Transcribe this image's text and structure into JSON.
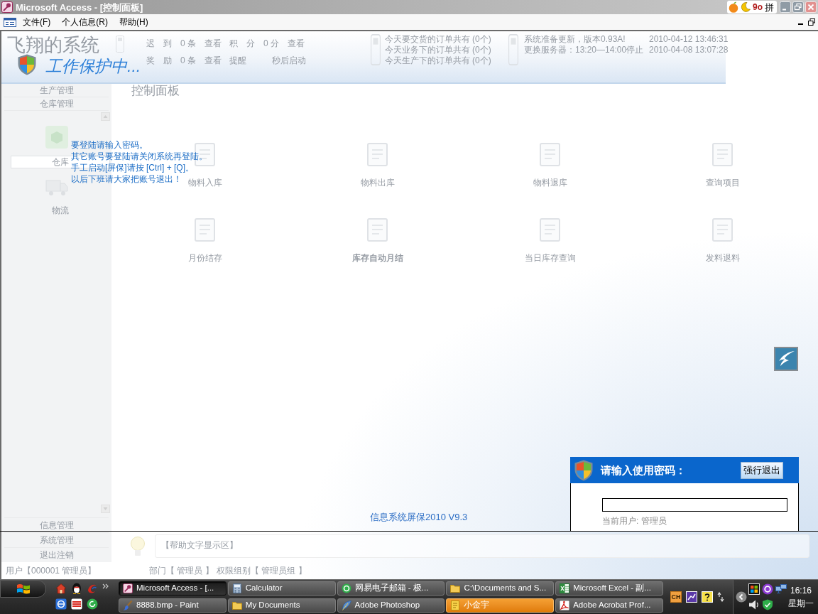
{
  "window": {
    "title": "Microsoft Access - [控制面板]"
  },
  "ime_toolbar": {
    "symbol": "9o",
    "mode": "拼"
  },
  "menu": {
    "items": [
      "文件(F)",
      "个人信息(R)",
      "帮助(H)"
    ]
  },
  "app_background": {
    "logo": "飞翔的系统",
    "stats": [
      {
        "label": "迟　到",
        "value": "0 条",
        "action": "查看"
      },
      {
        "label": "积　分",
        "value": "0 分",
        "action": "查看"
      },
      {
        "label": "奖　励",
        "value": "0 条",
        "action": "查看"
      }
    ],
    "reminder": {
      "label": "提醒",
      "suffix": "秒后启动"
    },
    "orders": [
      {
        "text": "今天要交货的订单共有",
        "count": "(0个)"
      },
      {
        "text": "今天业务下的订单共有",
        "count": "(0个)"
      },
      {
        "text": "今天生产下的订单共有",
        "count": "(0个)"
      }
    ],
    "news": [
      {
        "text": "系统准备更新，版本0.93A!",
        "date": "2010-04-12 13:46:31"
      },
      {
        "text": "更换服务器：13:20—14:00停止",
        "date": "2010-04-08 13:07:28"
      }
    ],
    "sidebar": {
      "top_items": [
        "生产管理",
        "仓库管理"
      ],
      "modules": [
        {
          "label": "仓库",
          "selected": true
        },
        {
          "label": "物流",
          "selected": false
        }
      ],
      "bottom_items": [
        "信息管理",
        "系统管理",
        "退出注销"
      ]
    },
    "panel_title": "控制面板",
    "tiles": [
      {
        "label": "物料入库",
        "highlighted": false
      },
      {
        "label": "物料出库",
        "highlighted": false
      },
      {
        "label": "物料退库",
        "highlighted": false
      },
      {
        "label": "查询项目",
        "highlighted": false
      },
      {
        "label": "月份结存",
        "highlighted": false
      },
      {
        "label": "库存自动月结",
        "highlighted": true
      },
      {
        "label": "当日库存查询",
        "highlighted": false
      },
      {
        "label": "发料退料",
        "highlighted": false
      }
    ],
    "help_text": "【帮助文字显示区】",
    "status": [
      "用户【000001 管理员】",
      "部门【 管理员 】",
      "权限组别【 管理员组 】"
    ]
  },
  "screensaver": {
    "title": "工作保护中...",
    "messages": [
      "要登陆请输入密码。",
      "其它账号要登陆请关闭系统再登陆。",
      "手工启动[屏保]请按 [Ctrl] + [Q]。",
      "以后下班请大家把账号退出！"
    ],
    "version": "信息系统屏保2010 V9.3"
  },
  "password_dialog": {
    "title": "请输入使用密码：",
    "exit_button": "强行退出",
    "current_user": "当前用户: 管理员"
  },
  "taskbar": {
    "tasks": [
      {
        "label": "Microsoft Access - [...",
        "kind": "key",
        "selected": true,
        "flashing": false
      },
      {
        "label": "Calculator",
        "kind": "calculator",
        "selected": false,
        "flashing": false
      },
      {
        "label": "网易电子邮箱 - 极...",
        "kind": "ring",
        "selected": false,
        "flashing": false
      },
      {
        "label": "C:\\Documents and S...",
        "kind": "folder",
        "selected": false,
        "flashing": false
      },
      {
        "label": "Microsoft Excel - 副...",
        "kind": "sheet",
        "selected": false,
        "flashing": false
      },
      {
        "label": "8888.bmp - Paint",
        "kind": "brush",
        "selected": false,
        "flashing": false
      },
      {
        "label": "My Documents",
        "kind": "folder",
        "selected": false,
        "flashing": false
      },
      {
        "label": "Adobe Photoshop",
        "kind": "feather",
        "selected": false,
        "flashing": false
      },
      {
        "label": "小金宇",
        "kind": "note",
        "selected": false,
        "flashing": true
      },
      {
        "label": "Adobe Acrobat Prof...",
        "kind": "swirl",
        "selected": false,
        "flashing": false
      }
    ],
    "tray": {
      "language": "CH",
      "time": "16:16",
      "day": "星期一"
    }
  }
}
